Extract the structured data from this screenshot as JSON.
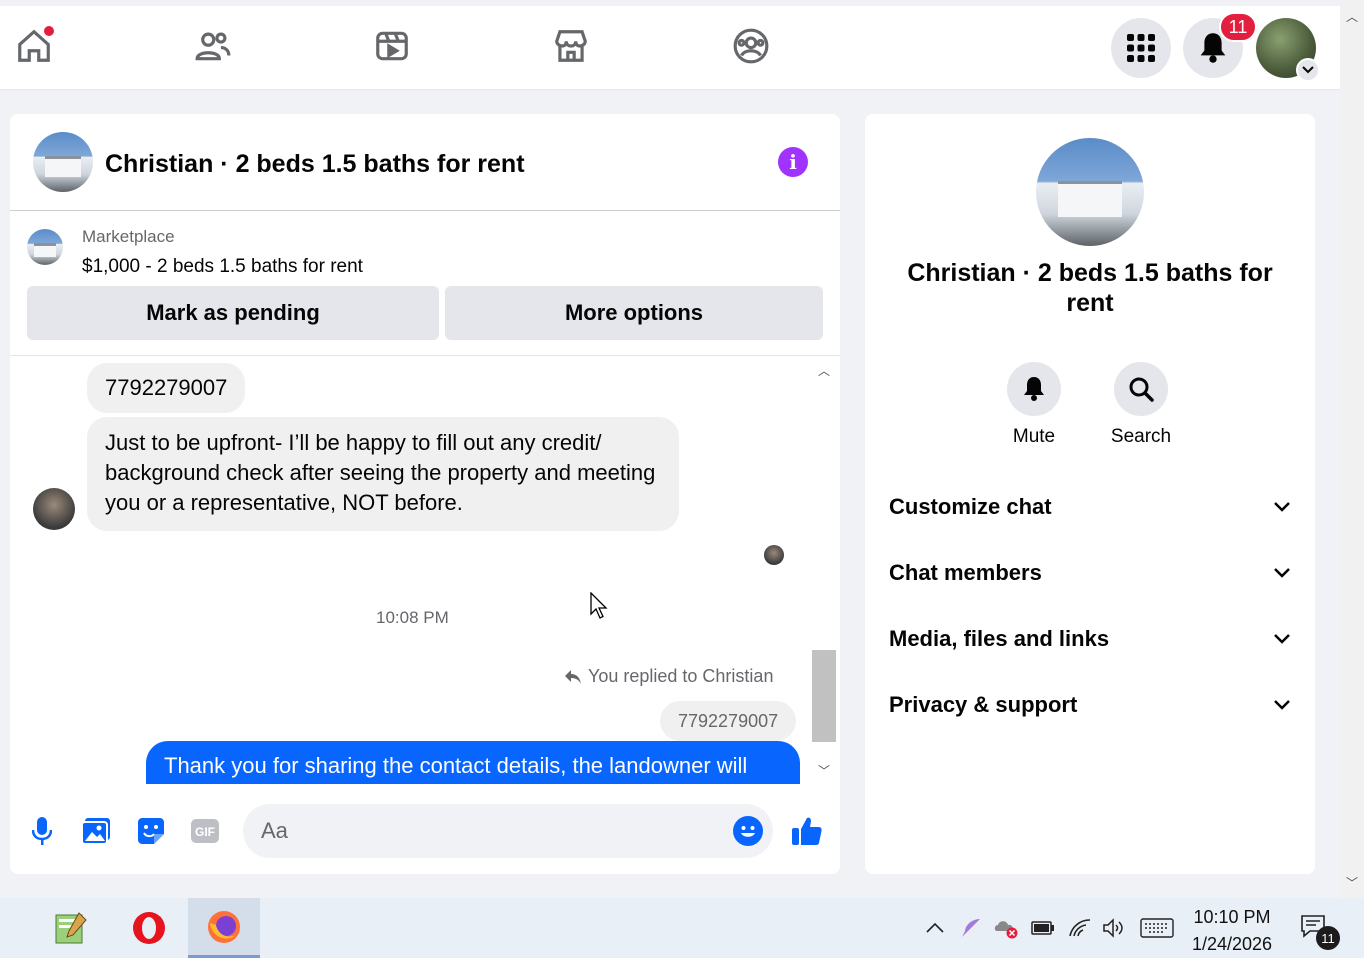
{
  "colors": {
    "accent": "#0866ff",
    "info": "#a033ff",
    "badge": "#e41e3f"
  },
  "nav": {
    "tabs": [
      "home-icon",
      "friends-icon",
      "video-icon",
      "marketplace-icon",
      "groups-icon"
    ],
    "menu_icon": "grid-menu-icon",
    "notifications_count": "11"
  },
  "chat": {
    "title": "Christian · 2 beds 1.5 baths for rent",
    "listing": {
      "label": "Marketplace",
      "price_line": "$1,000 - 2 beds 1.5 baths for rent"
    },
    "buttons": {
      "pending": "Mark as pending",
      "more": "More options"
    },
    "messages": {
      "phone1": "7792279007",
      "upfront": "Just to be upfront- I’ll be happy to fill out any credit/ background check after seeing the property and meeting you or a representative, NOT before.",
      "timestamp": "10:08 PM",
      "reply_note": "You replied to Christian",
      "quoted": "7792279007",
      "outgoing": "Thank you for sharing the contact details, the landowner will"
    },
    "composer": {
      "placeholder": "Aa"
    }
  },
  "info_panel": {
    "title": "Christian · 2 beds 1.5 baths for rent",
    "mute": "Mute",
    "search": "Search",
    "sections": [
      "Customize chat",
      "Chat members",
      "Media, files and links",
      "Privacy & support"
    ]
  },
  "taskbar": {
    "time": "10:10 PM",
    "date": "1/24/2026",
    "notification_count": "11"
  }
}
